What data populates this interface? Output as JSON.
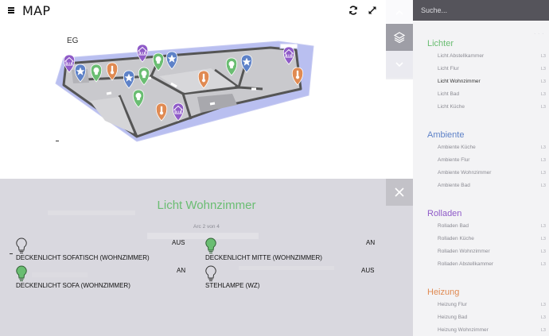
{
  "header": {
    "title": "MAP",
    "refresh_icon": "refresh-icon",
    "fullscreen_icon": "fullscreen-icon"
  },
  "map": {
    "floor_label": "EG",
    "controls": [
      "chevron-up-icon",
      "layers-icon",
      "chevron-down-icon"
    ]
  },
  "search": {
    "placeholder": "Suche..."
  },
  "sidebar": {
    "groups": [
      {
        "title": "Lichter",
        "color": "#6abd72",
        "items": [
          {
            "label": "Licht Abstellkammer",
            "suffix": "L3"
          },
          {
            "label": "Licht Flur",
            "suffix": "L3"
          },
          {
            "label": "Licht Wohnzimmer",
            "suffix": "L3",
            "active": true
          },
          {
            "label": "Licht Bad",
            "suffix": "L3"
          },
          {
            "label": "Licht Küche",
            "suffix": "L3"
          }
        ]
      },
      {
        "title": "Ambiente",
        "color": "#5e82c8",
        "items": [
          {
            "label": "Ambiente Küche",
            "suffix": "L3"
          },
          {
            "label": "Ambiente Flur",
            "suffix": "L3"
          },
          {
            "label": "Ambiente Wohnzimmer",
            "suffix": "L3"
          },
          {
            "label": "Ambiente Bad",
            "suffix": "L3"
          }
        ]
      },
      {
        "title": "Rolladen",
        "color": "#8f5bc8",
        "items": [
          {
            "label": "Rolladen Bad",
            "suffix": "L3"
          },
          {
            "label": "Rolladen Küche",
            "suffix": "L3"
          },
          {
            "label": "Rolladen Wohnzimmer",
            "suffix": "L3"
          },
          {
            "label": "Rolladen Abstellkammer",
            "suffix": "L3"
          }
        ]
      },
      {
        "title": "Heizung",
        "color": "#e08a52",
        "items": [
          {
            "label": "Heizung Flur",
            "suffix": "L3"
          },
          {
            "label": "Heizung Bad",
            "suffix": "L3"
          },
          {
            "label": "Heizung Wohnzimmer",
            "suffix": "L3"
          }
        ]
      }
    ]
  },
  "panel": {
    "title": "Licht Wohnzimmer",
    "counter": "Arc 2 von 4",
    "lights": [
      {
        "label": "DECKENLICHT SOFATISCH (WOHNZIMMER)",
        "state": "AUS",
        "on": false
      },
      {
        "label": "DECKENLICHT MITTE (WOHNZIMMER)",
        "state": "AN",
        "on": true
      },
      {
        "label": "DECKENLICHT SOFA (WOHNZIMMER)",
        "state": "AN",
        "on": true
      },
      {
        "label": "STEHLAMPE (WZ)",
        "state": "AUS",
        "on": false
      }
    ],
    "close_icon": "close-icon"
  },
  "colors": {
    "search_bar": "#55545b",
    "sidebar_bg": "#f3f3f5",
    "panel_bg": "#d9d8df",
    "light_on": "#6abd72"
  }
}
